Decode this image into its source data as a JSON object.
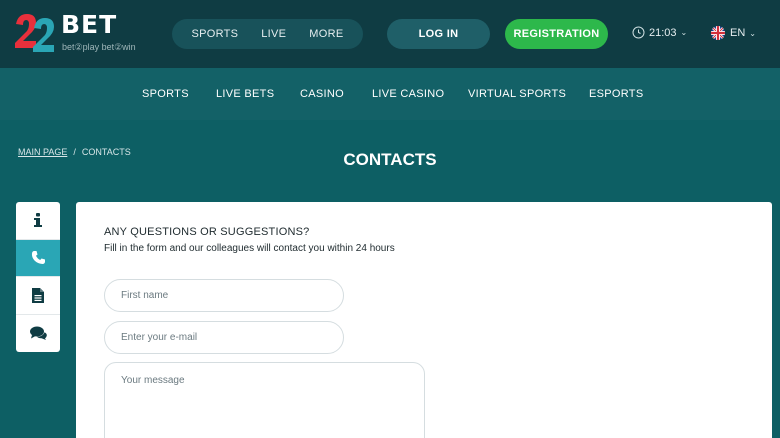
{
  "header": {
    "logo_bet": "BET",
    "logo_tagline": "bet②play  bet②win",
    "nav_pill": [
      "SPORTS",
      "LIVE",
      "MORE"
    ],
    "login_label": "LOG IN",
    "register_label": "REGISTRATION",
    "time": "21:03",
    "language": "EN"
  },
  "subnav": [
    "SPORTS",
    "LIVE BETS",
    "CASINO",
    "LIVE CASINO",
    "VIRTUAL SPORTS",
    "ESPORTS"
  ],
  "breadcrumb": {
    "home": "MAIN PAGE",
    "separator": "/",
    "current": "CONTACTS"
  },
  "page_title": "CONTACTS",
  "side_tabs": [
    {
      "icon": "info-icon",
      "active": false
    },
    {
      "icon": "phone-icon",
      "active": true
    },
    {
      "icon": "document-icon",
      "active": false
    },
    {
      "icon": "chat-icon",
      "active": false
    }
  ],
  "form": {
    "title": "ANY QUESTIONS OR SUGGESTIONS?",
    "subtitle": "Fill in the form and our colleagues will contact you within 24 hours",
    "name_placeholder": "First name",
    "email_placeholder": "Enter your e-mail",
    "message_placeholder": "Your message"
  },
  "colors": {
    "header_bg": "#0f3c43",
    "subnav_bg": "#136167",
    "page_bg": "#0d5f64",
    "register_green": "#2db84b",
    "active_tab": "#2aa6b5",
    "logo_red": "#e8303c",
    "logo_teal": "#2aa6b5"
  }
}
